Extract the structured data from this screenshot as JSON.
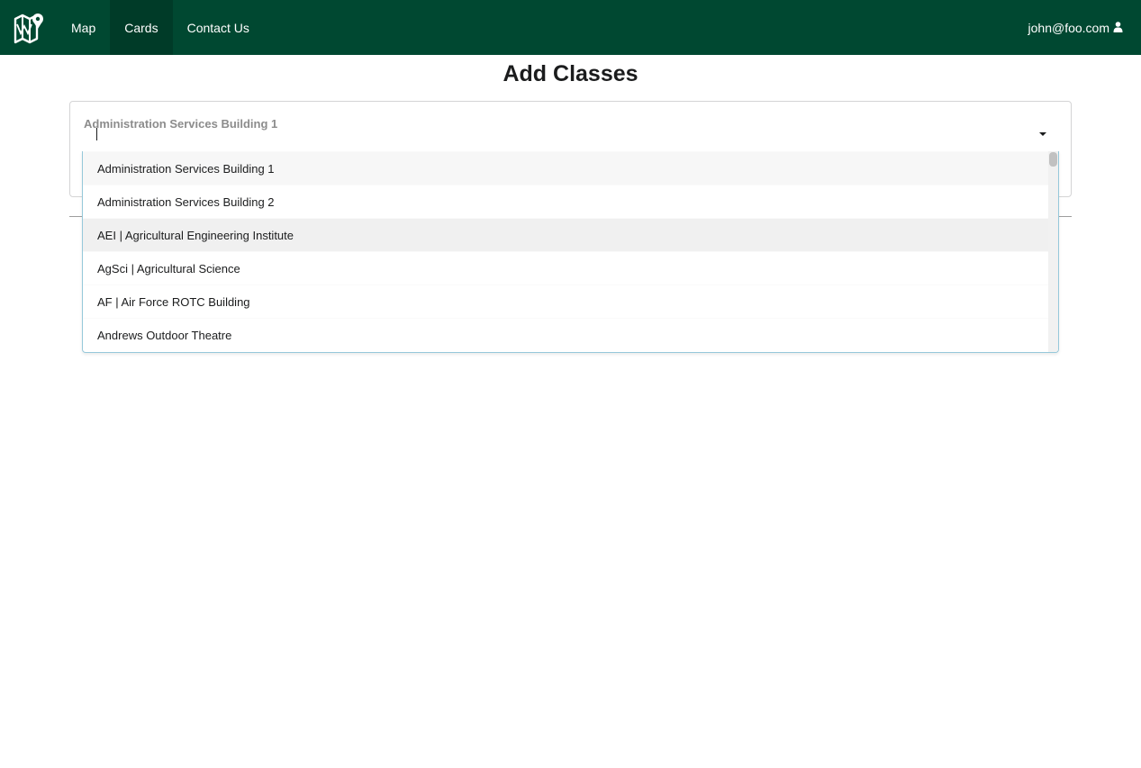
{
  "navbar": {
    "logo_icon": "map-logo-icon",
    "items": [
      {
        "label": "Map",
        "active": false
      },
      {
        "label": "Cards",
        "active": true
      },
      {
        "label": "Contact Us",
        "active": false
      }
    ],
    "user": {
      "email": "john@foo.com",
      "icon": "user-icon"
    }
  },
  "page": {
    "title": "Add Classes"
  },
  "building_select": {
    "value": "Administration Services Building 1",
    "caret_icon": "caret-down-icon",
    "options": [
      "Administration Services Building 1",
      "Administration Services Building 2",
      "AEI | Agricultural Engineering Institute",
      "AgSci | Agricultural Science",
      "AF | Air Force ROTC Building",
      "Andrews Outdoor Theatre"
    ]
  },
  "colors": {
    "navbar_bg": "#004831",
    "navbar_active_bg": "#003b28",
    "menu_border": "#96c8da"
  }
}
